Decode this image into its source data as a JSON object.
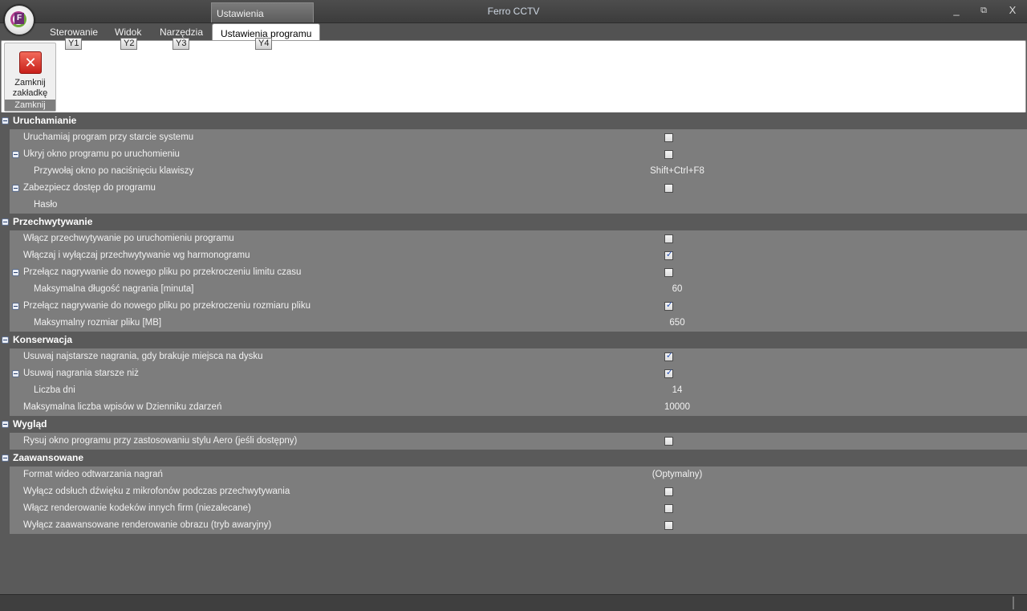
{
  "window": {
    "title": "Ferro CCTV",
    "minimize": "_",
    "restore": "⧉",
    "close": "X"
  },
  "context_group": "Ustawienia",
  "tabs": [
    {
      "label": "Sterowanie",
      "keytip": "Y1"
    },
    {
      "label": "Widok",
      "keytip": "Y2"
    },
    {
      "label": "Narzędzia",
      "keytip": "Y3"
    },
    {
      "label": "Ustawienia programu",
      "keytip": "Y4",
      "active": true
    }
  ],
  "ribbon": {
    "group_label": "Zamknij",
    "close_button_label": "Zamknij zakładkę",
    "close_icon": "✕"
  },
  "categories": [
    {
      "label": "Uruchamianie",
      "items": [
        {
          "label": "Uruchamiaj program przy starcie systemu",
          "type": "checkbox",
          "checked": false
        },
        {
          "label": "Ukryj okno programu po uruchomieniu",
          "type": "checkbox",
          "checked": false
        },
        {
          "label": "Przywołaj okno po naciśnięciu klawiszy",
          "type": "text",
          "value": "Shift+Ctrl+F8"
        },
        {
          "label": "Zabezpiecz dostęp do programu",
          "type": "checkbox",
          "checked": false
        },
        {
          "label": "Hasło",
          "type": "text",
          "value": ""
        }
      ]
    },
    {
      "label": "Przechwytywanie",
      "items": [
        {
          "label": "Włącz przechwytywanie po uruchomieniu programu",
          "type": "checkbox",
          "checked": false
        },
        {
          "label": "Włączaj i wyłączaj przechwytywanie wg harmonogramu",
          "type": "checkbox",
          "checked": true
        },
        {
          "label": "Przełącz nagrywanie do nowego pliku po przekroczeniu limitu czasu",
          "type": "checkbox",
          "checked": false
        },
        {
          "label": "Maksymalna długość nagrania [minuta]",
          "type": "text",
          "value": "60"
        },
        {
          "label": "Przełącz nagrywanie do nowego pliku po przekroczeniu rozmiaru pliku",
          "type": "checkbox",
          "checked": true
        },
        {
          "label": "Maksymalny rozmiar pliku [MB]",
          "type": "text",
          "value": "650"
        }
      ]
    },
    {
      "label": "Konserwacja",
      "items": [
        {
          "label": "Usuwaj najstarsze nagrania, gdy brakuje miejsca na dysku",
          "type": "checkbox",
          "checked": true
        },
        {
          "label": "Usuwaj nagrania starsze niż",
          "type": "checkbox",
          "checked": true
        },
        {
          "label": "Liczba dni",
          "type": "text",
          "value": "14"
        },
        {
          "label": "Maksymalna liczba wpisów w Dzienniku zdarzeń",
          "type": "text",
          "value": "10000"
        }
      ]
    },
    {
      "label": "Wygląd",
      "items": [
        {
          "label": "Rysuj okno programu przy zastosowaniu stylu Aero (jeśli dostępny)",
          "type": "checkbox",
          "checked": false
        }
      ]
    },
    {
      "label": "Zaawansowane",
      "items": [
        {
          "label": "Format wideo odtwarzania nagrań",
          "type": "text",
          "value": "(Optymalny)"
        },
        {
          "label": "Wyłącz odsłuch dźwięku z mikrofonów podczas przechwytywania",
          "type": "checkbox",
          "checked": false
        },
        {
          "label": "Włącz renderowanie kodeków innych firm (niezalecane)",
          "type": "checkbox",
          "checked": false
        },
        {
          "label": "Wyłącz zaawansowane renderowanie obrazu (tryb awaryjny)",
          "type": "checkbox",
          "checked": false
        }
      ]
    }
  ]
}
